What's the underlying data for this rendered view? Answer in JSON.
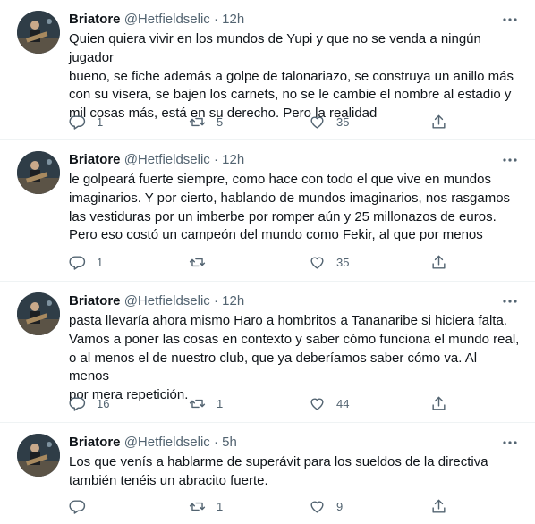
{
  "tweets": [
    {
      "name": "Briatore",
      "handle": "@Hetfieldselic",
      "separator": "·",
      "time": "12h",
      "text": "Quien quiera vivir en los mundos de Yupi y que no se venda a ningún jugador\nbueno, se fiche además a golpe de talonariazo, se construya un anillo más\ncon su visera, se bajen los carnets, no se le cambie el nombre al estadio y\nmil cosas más, está en su derecho. Pero la realidad",
      "replies": "1",
      "retweets": "5",
      "likes": "35"
    },
    {
      "name": "Briatore",
      "handle": "@Hetfieldselic",
      "separator": "·",
      "time": "12h",
      "text": "le golpeará fuerte siempre, como hace con todo el que vive en mundos\nimaginarios. Y por cierto, hablando de mundos imaginarios, nos rasgamos\nlas vestiduras por un imberbe por romper aún y 25 millonazos de euros.\nPero eso costó un campeón del mundo como Fekir, al que por menos",
      "replies": "1",
      "retweets": "",
      "likes": "35"
    },
    {
      "name": "Briatore",
      "handle": "@Hetfieldselic",
      "separator": "·",
      "time": "12h",
      "text": "pasta llevaría ahora mismo Haro a hombritos a Tananaribe si hiciera falta.\nVamos a poner las cosas en contexto y saber cómo funciona el mundo real,\no al menos el de nuestro club, que ya deberíamos saber cómo va. Al menos\npor mera repetición.",
      "replies": "16",
      "retweets": "1",
      "likes": "44"
    },
    {
      "name": "Briatore",
      "handle": "@Hetfieldselic",
      "separator": "·",
      "time": "5h",
      "text": "Los que venís a hablarme de superávit para los sueldos de la directiva\ntambién tenéis un abracito fuerte.",
      "replies": "",
      "retweets": "1",
      "likes": "9"
    }
  ],
  "icons": {
    "reply": "reply-icon",
    "retweet": "retweet-icon",
    "like": "heart-icon",
    "share": "share-icon",
    "more": "more-icon",
    "avatar": "avatar"
  },
  "colors": {
    "text": "#0f1419",
    "secondary": "#536471",
    "border": "#eff3f4"
  }
}
